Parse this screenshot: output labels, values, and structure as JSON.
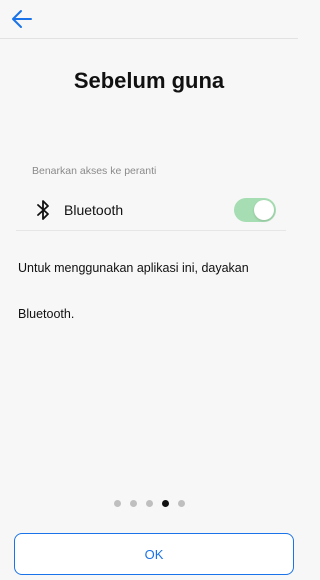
{
  "header": {
    "back_icon": "arrow-left-icon"
  },
  "page": {
    "title": "Sebelum guna"
  },
  "permissions": {
    "section_label": "Benarkan akses ke peranti",
    "items": [
      {
        "icon": "bluetooth-icon",
        "label": "Bluetooth",
        "enabled": true
      }
    ]
  },
  "description": "Untuk menggunakan aplikasi ini, dayakan Bluetooth.",
  "pager": {
    "total": 5,
    "current": 4
  },
  "footer": {
    "ok_label": "OK"
  },
  "colors": {
    "accent": "#1a73e8",
    "toggle_on": "#a6ddb2",
    "background": "#f7f7f7"
  }
}
